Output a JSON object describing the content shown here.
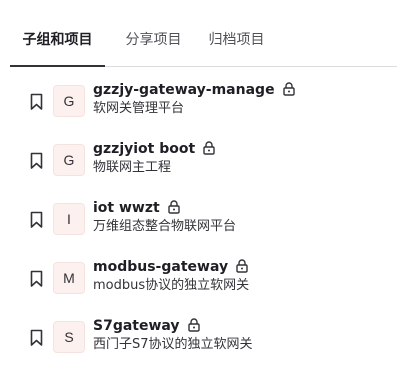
{
  "tabs": [
    {
      "label": "子组和项目",
      "active": true
    },
    {
      "label": "分享项目",
      "active": false
    },
    {
      "label": "归档项目",
      "active": false
    }
  ],
  "projects": [
    {
      "avatar": "G",
      "name": "gzzjy-gateway-manage",
      "description": "软网关管理平台",
      "icon": "lock-icon"
    },
    {
      "avatar": "G",
      "name": "gzzjyiot boot",
      "description": "物联网主工程",
      "icon": "lock-icon"
    },
    {
      "avatar": "I",
      "name": "iot wwzt",
      "description": "万维组态整合物联网平台",
      "icon": "lock-icon"
    },
    {
      "avatar": "M",
      "name": "modbus-gateway",
      "description": "modbus协议的独立软网关",
      "icon": "lock-icon"
    },
    {
      "avatar": "S",
      "name": "S7gateway",
      "description": "西门子S7协议的独立软网关",
      "icon": "lock-icon"
    }
  ],
  "colors": {
    "avatar_bg": "#fcf1ef",
    "text": "#1f1e24",
    "active_underline": "#333238"
  }
}
